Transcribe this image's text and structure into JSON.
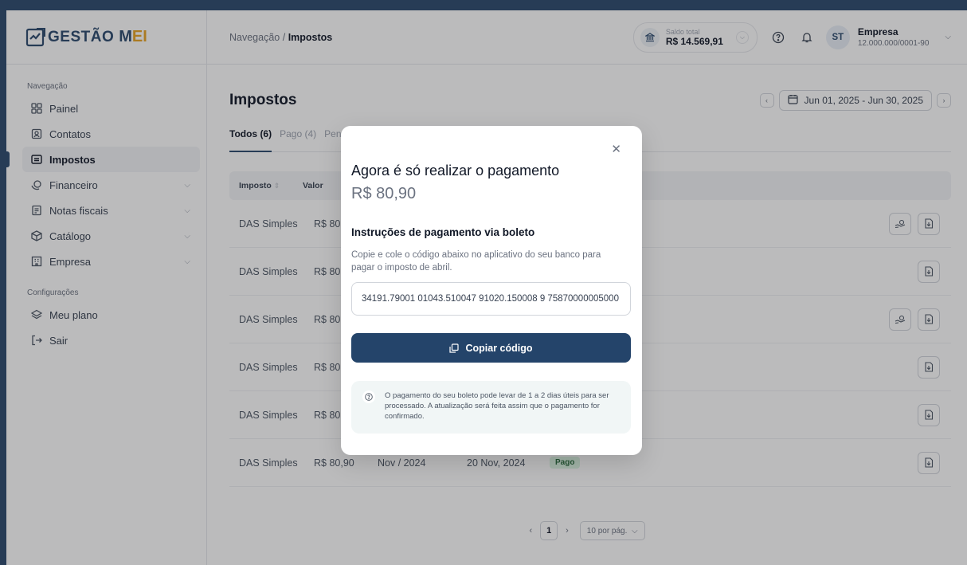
{
  "brand": {
    "name": "GESTÃO",
    "mei": "MEI",
    "mei_m": "M",
    "mei_e": "E",
    "mei_i": "I"
  },
  "topbar": {
    "breadcrumb_parent": "Navegação",
    "breadcrumb_sep": "/",
    "breadcrumb_current": "Impostos",
    "balance_label": "Saldo total",
    "balance_value": "R$ 14.569,91",
    "avatar_initials": "ST",
    "company_name": "Empresa",
    "company_cnpj": "12.000.000/0001-90"
  },
  "sidebar": {
    "section_nav": "Navegação",
    "section_config": "Configurações",
    "items": [
      {
        "label": "Painel",
        "icon": "grid-icon"
      },
      {
        "label": "Contatos",
        "icon": "contact-icon"
      },
      {
        "label": "Impostos",
        "icon": "tax-icon",
        "active": true
      },
      {
        "label": "Financeiro",
        "icon": "money-icon"
      },
      {
        "label": "Notas fiscais",
        "icon": "receipt-icon"
      },
      {
        "label": "Catálogo",
        "icon": "box-icon"
      },
      {
        "label": "Empresa",
        "icon": "building-icon"
      },
      {
        "label": "Meu plano",
        "icon": "layers-icon"
      },
      {
        "label": "Sair",
        "icon": "logout-icon"
      }
    ]
  },
  "page": {
    "title": "Impostos",
    "date_range": "Jun 01, 2025 - Jun 30, 2025",
    "tabs": [
      "Todos (6)",
      "Pago (4)",
      "Pen"
    ],
    "columns": [
      "Imposto",
      "Valor"
    ],
    "rows": [
      {
        "tax": "DAS Simples",
        "value": "R$ 80"
      },
      {
        "tax": "DAS Simples",
        "value": "R$ 80"
      },
      {
        "tax": "DAS Simples",
        "value": "R$ 80"
      },
      {
        "tax": "DAS Simples",
        "value": "R$ 80"
      },
      {
        "tax": "DAS Simples",
        "value": "R$ 80"
      },
      {
        "tax": "DAS Simples",
        "value": "R$ 80,90",
        "period": "Nov / 2024",
        "date": "20 Nov, 2024",
        "status": "Pago"
      }
    ],
    "pager": {
      "page": "1",
      "per_page": "10 por pág."
    }
  },
  "modal": {
    "title": "Agora é só realizar o pagamento",
    "amount": "R$ 80,90",
    "subtitle": "Instruções de pagamento via boleto",
    "description": "Copie e cole o código abaixo no aplicativo do seu banco para pagar o imposto de abril.",
    "code": "34191.79001 01043.510047 91020.150008 9 75870000005000",
    "copy_label": "Copiar código",
    "info": "O pagamento do seu boleto pode levar de 1 a 2 dias úteis para ser processado. A atualização será feita assim que o pagamento for confirmado."
  },
  "colors": {
    "brand": "#2c4a6e",
    "accent": "#e8a425",
    "button": "#24446a"
  }
}
